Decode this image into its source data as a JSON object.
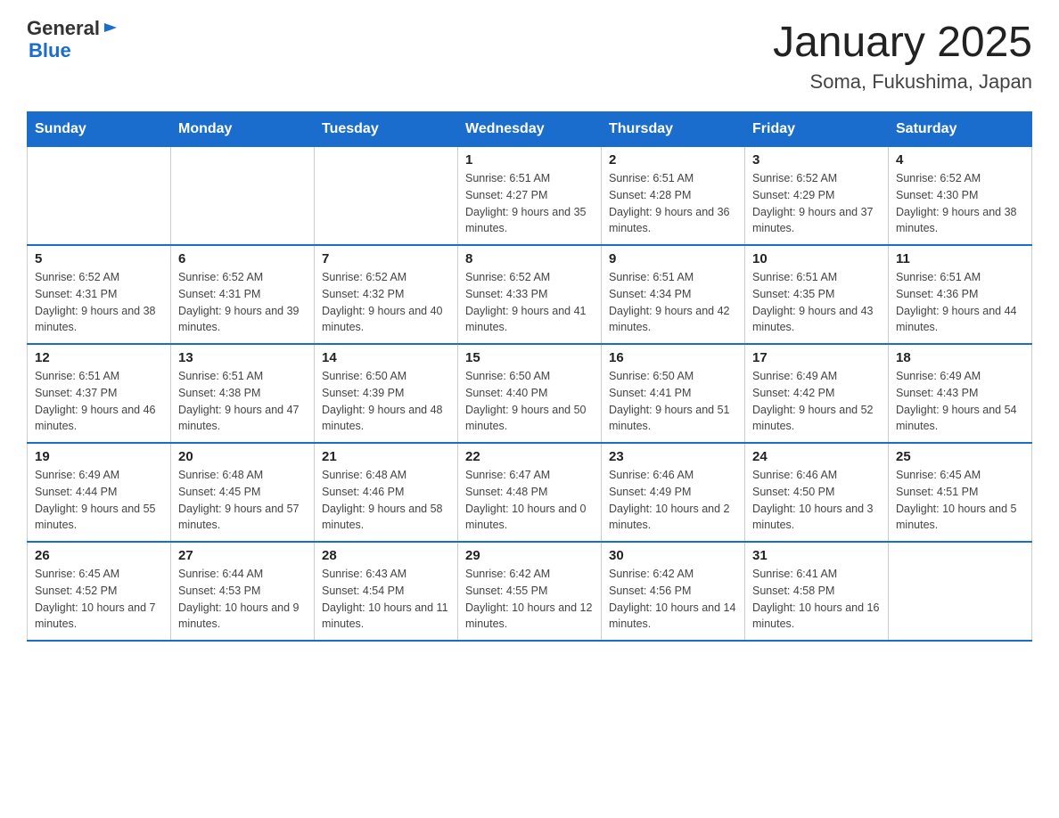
{
  "logo": {
    "text_general": "General",
    "text_blue": "Blue"
  },
  "header": {
    "title": "January 2025",
    "subtitle": "Soma, Fukushima, Japan"
  },
  "weekdays": [
    "Sunday",
    "Monday",
    "Tuesday",
    "Wednesday",
    "Thursday",
    "Friday",
    "Saturday"
  ],
  "weeks": [
    [
      {
        "day": "",
        "info": ""
      },
      {
        "day": "",
        "info": ""
      },
      {
        "day": "",
        "info": ""
      },
      {
        "day": "1",
        "info": "Sunrise: 6:51 AM\nSunset: 4:27 PM\nDaylight: 9 hours and 35 minutes."
      },
      {
        "day": "2",
        "info": "Sunrise: 6:51 AM\nSunset: 4:28 PM\nDaylight: 9 hours and 36 minutes."
      },
      {
        "day": "3",
        "info": "Sunrise: 6:52 AM\nSunset: 4:29 PM\nDaylight: 9 hours and 37 minutes."
      },
      {
        "day": "4",
        "info": "Sunrise: 6:52 AM\nSunset: 4:30 PM\nDaylight: 9 hours and 38 minutes."
      }
    ],
    [
      {
        "day": "5",
        "info": "Sunrise: 6:52 AM\nSunset: 4:31 PM\nDaylight: 9 hours and 38 minutes."
      },
      {
        "day": "6",
        "info": "Sunrise: 6:52 AM\nSunset: 4:31 PM\nDaylight: 9 hours and 39 minutes."
      },
      {
        "day": "7",
        "info": "Sunrise: 6:52 AM\nSunset: 4:32 PM\nDaylight: 9 hours and 40 minutes."
      },
      {
        "day": "8",
        "info": "Sunrise: 6:52 AM\nSunset: 4:33 PM\nDaylight: 9 hours and 41 minutes."
      },
      {
        "day": "9",
        "info": "Sunrise: 6:51 AM\nSunset: 4:34 PM\nDaylight: 9 hours and 42 minutes."
      },
      {
        "day": "10",
        "info": "Sunrise: 6:51 AM\nSunset: 4:35 PM\nDaylight: 9 hours and 43 minutes."
      },
      {
        "day": "11",
        "info": "Sunrise: 6:51 AM\nSunset: 4:36 PM\nDaylight: 9 hours and 44 minutes."
      }
    ],
    [
      {
        "day": "12",
        "info": "Sunrise: 6:51 AM\nSunset: 4:37 PM\nDaylight: 9 hours and 46 minutes."
      },
      {
        "day": "13",
        "info": "Sunrise: 6:51 AM\nSunset: 4:38 PM\nDaylight: 9 hours and 47 minutes."
      },
      {
        "day": "14",
        "info": "Sunrise: 6:50 AM\nSunset: 4:39 PM\nDaylight: 9 hours and 48 minutes."
      },
      {
        "day": "15",
        "info": "Sunrise: 6:50 AM\nSunset: 4:40 PM\nDaylight: 9 hours and 50 minutes."
      },
      {
        "day": "16",
        "info": "Sunrise: 6:50 AM\nSunset: 4:41 PM\nDaylight: 9 hours and 51 minutes."
      },
      {
        "day": "17",
        "info": "Sunrise: 6:49 AM\nSunset: 4:42 PM\nDaylight: 9 hours and 52 minutes."
      },
      {
        "day": "18",
        "info": "Sunrise: 6:49 AM\nSunset: 4:43 PM\nDaylight: 9 hours and 54 minutes."
      }
    ],
    [
      {
        "day": "19",
        "info": "Sunrise: 6:49 AM\nSunset: 4:44 PM\nDaylight: 9 hours and 55 minutes."
      },
      {
        "day": "20",
        "info": "Sunrise: 6:48 AM\nSunset: 4:45 PM\nDaylight: 9 hours and 57 minutes."
      },
      {
        "day": "21",
        "info": "Sunrise: 6:48 AM\nSunset: 4:46 PM\nDaylight: 9 hours and 58 minutes."
      },
      {
        "day": "22",
        "info": "Sunrise: 6:47 AM\nSunset: 4:48 PM\nDaylight: 10 hours and 0 minutes."
      },
      {
        "day": "23",
        "info": "Sunrise: 6:46 AM\nSunset: 4:49 PM\nDaylight: 10 hours and 2 minutes."
      },
      {
        "day": "24",
        "info": "Sunrise: 6:46 AM\nSunset: 4:50 PM\nDaylight: 10 hours and 3 minutes."
      },
      {
        "day": "25",
        "info": "Sunrise: 6:45 AM\nSunset: 4:51 PM\nDaylight: 10 hours and 5 minutes."
      }
    ],
    [
      {
        "day": "26",
        "info": "Sunrise: 6:45 AM\nSunset: 4:52 PM\nDaylight: 10 hours and 7 minutes."
      },
      {
        "day": "27",
        "info": "Sunrise: 6:44 AM\nSunset: 4:53 PM\nDaylight: 10 hours and 9 minutes."
      },
      {
        "day": "28",
        "info": "Sunrise: 6:43 AM\nSunset: 4:54 PM\nDaylight: 10 hours and 11 minutes."
      },
      {
        "day": "29",
        "info": "Sunrise: 6:42 AM\nSunset: 4:55 PM\nDaylight: 10 hours and 12 minutes."
      },
      {
        "day": "30",
        "info": "Sunrise: 6:42 AM\nSunset: 4:56 PM\nDaylight: 10 hours and 14 minutes."
      },
      {
        "day": "31",
        "info": "Sunrise: 6:41 AM\nSunset: 4:58 PM\nDaylight: 10 hours and 16 minutes."
      },
      {
        "day": "",
        "info": ""
      }
    ]
  ]
}
